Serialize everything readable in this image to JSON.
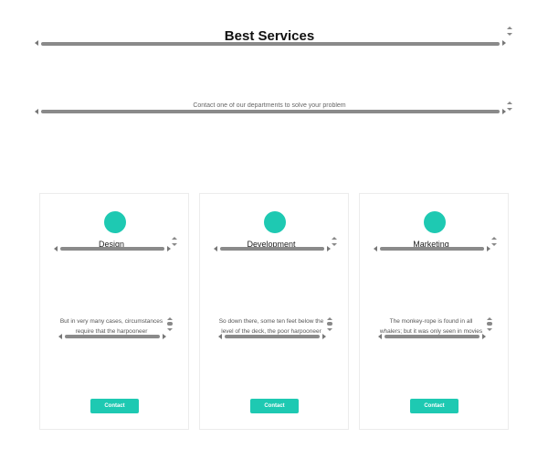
{
  "header": {
    "title": "Best Services",
    "subtitle": "Contact one of our departments to solve your problem"
  },
  "colors": {
    "accent": "#1ec9b2",
    "scrollbar": "#8a8a8a",
    "card_border": "#ececec"
  },
  "services": [
    {
      "name": "Design",
      "description": "But in very many cases, circumstances require that the harpooneer",
      "button_label": "Contact"
    },
    {
      "name": "Development",
      "description": "So down there, some ten feet below the level of the deck, the poor harpooneer",
      "button_label": "Contact"
    },
    {
      "name": "Marketing",
      "description": "The monkey-rope is found in all whalers; but it was only seen in movies",
      "button_label": "Contact"
    }
  ]
}
